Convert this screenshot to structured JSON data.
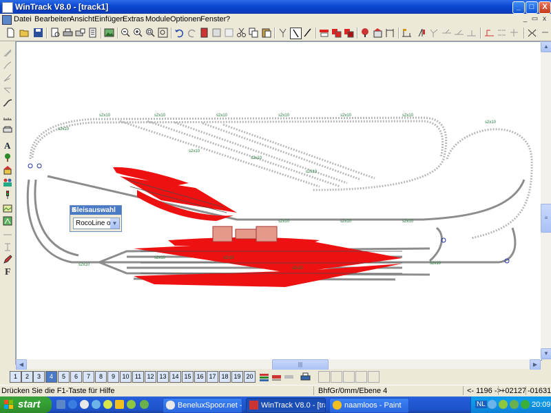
{
  "window": {
    "title": "WinTrack  V8.0 - [track1]",
    "controls": {
      "minimize": "_",
      "maximize": "□",
      "close": "X"
    }
  },
  "menu": {
    "items": [
      "Datei",
      "Bearbeiten",
      "Ansicht",
      "Einfügen",
      "Extras",
      "Module",
      "Optionen",
      "Fenster",
      "?"
    ],
    "doc_controls": {
      "minimize": "_",
      "restore": "▭",
      "close": "x"
    }
  },
  "gleisauswahl": {
    "title": "Gleisauswahl",
    "close": "X",
    "selected": "RocoLine ohn"
  },
  "layers": {
    "buttons": [
      "1",
      "2",
      "3",
      "4",
      "5",
      "6",
      "7",
      "8",
      "9",
      "10",
      "11",
      "12",
      "13",
      "14",
      "15",
      "16",
      "17",
      "18",
      "19",
      "20"
    ]
  },
  "statusbar": {
    "help": "Drücken Sie die  F1-Taste für Hilfe",
    "info": "BhfGr/0mm/Ebene 4",
    "zoom": "<- 1196 ->",
    "x": "+02127",
    "y": "-01631"
  },
  "taskbar": {
    "start": "start",
    "tasks": [
      {
        "label": "BeneluxSpoor.net - A..."
      },
      {
        "label": "WinTrack  V8.0 - [tra..."
      },
      {
        "label": "naamloos - Paint"
      }
    ],
    "lang": "NL",
    "clock": "20:09"
  },
  "track_labels": {
    "segment": "s2x10"
  },
  "colors": {
    "title_blue": "#0a47d1",
    "platform_red": "#ee1111",
    "track_gray": "#8c8c8c",
    "label_green": "#1f7a3a",
    "start_green": "#36a535"
  }
}
